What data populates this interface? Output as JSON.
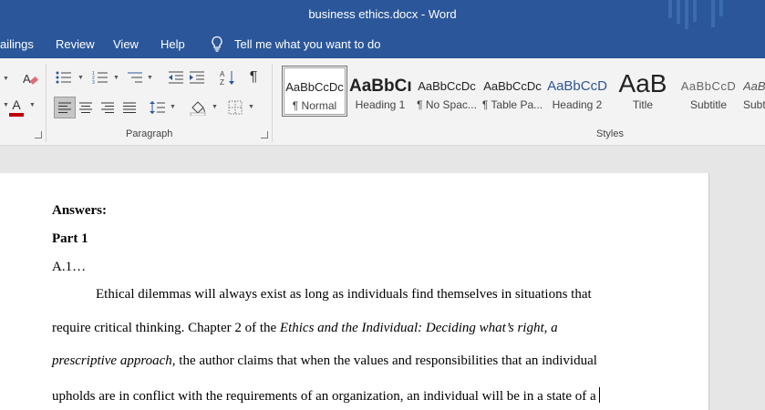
{
  "window": {
    "title": "business ethics.docx  -  Word"
  },
  "menu": {
    "tabs": [
      "ailings",
      "Review",
      "View",
      "Help"
    ],
    "tell_me": "Tell me what you want to do"
  },
  "ribbon": {
    "groups": {
      "paragraph": "Paragraph",
      "styles": "Styles"
    },
    "styles": [
      {
        "preview": "AaBbCcDc",
        "name": "¶ Normal"
      },
      {
        "preview": "AaBbCı",
        "name": "Heading 1"
      },
      {
        "preview": "AaBbCcDc",
        "name": "¶ No Spac..."
      },
      {
        "preview": "AaBbCcDc",
        "name": "¶ Table Pa..."
      },
      {
        "preview": "AaBbCcD",
        "name": "Heading 2"
      },
      {
        "preview": "AaB",
        "name": "Title"
      },
      {
        "preview": "AaBbCcD",
        "name": "Subtitle"
      },
      {
        "preview": "AaBl",
        "name": "Subt"
      }
    ],
    "colors": {
      "font_color": "#c00000",
      "heading2": "#2f5496"
    }
  },
  "document": {
    "answers": "Answers:",
    "part": "Part 1",
    "section": "A.1…",
    "p1": "Ethical dilemmas will always exist as long as individuals find themselves in situations that",
    "p2_plain": "require critical thinking. Chapter 2 of the ",
    "p2_italic": "Ethics and the Individual: Deciding what’s right, a",
    "p3_italic": "prescriptive approach,",
    "p3_plain": " the author claims that when the values and responsibilities that an individual",
    "p4": "upholds are in conflict with the requirements of an organization, an individual will be in a state of a"
  }
}
